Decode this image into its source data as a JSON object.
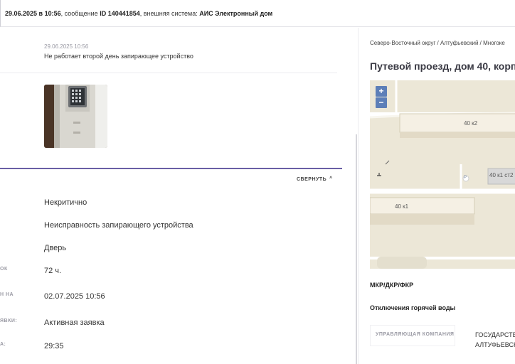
{
  "topbar": {
    "datetime": "29.06.2025 в 10:56",
    "message_prefix": ", сообщение ",
    "message_id": "ID 140441854",
    "system_prefix": ", внешняя система: ",
    "system_name": "АИС Электронный дом"
  },
  "message": {
    "date": "29.06.2025 10:56",
    "text": "Не работает второй день запирающее устройство"
  },
  "details": {
    "collapse_label": "СВЕРНУТЬ",
    "fields": [
      {
        "label": "",
        "value": "Некритично"
      },
      {
        "label": "",
        "value": "Неисправность запирающего устройства"
      },
      {
        "label": "",
        "value": "Дверь"
      },
      {
        "label": "ОК",
        "value": "72 ч."
      },
      {
        "label": "Н НА",
        "value": "02.07.2025 10:56"
      },
      {
        "label": "ЯВКИ:",
        "value": "Активная заявка"
      },
      {
        "label": "А:",
        "value": "29:35"
      }
    ]
  },
  "right": {
    "breadcrumb": "Северо-Восточный округ / Алтуфьевский / Многоке",
    "address": "Путевой проезд, дом 40, корпус",
    "map": {
      "zoom_in": "+",
      "zoom_out": "−",
      "labels": [
        "40 к2",
        "40 к1 ст2",
        "40 к1"
      ],
      "parking": "P"
    },
    "program_label": "МКР/ДКР/ФКР",
    "hot_water_label": "Отключения горячей воды",
    "company_label": "УПРАВЛЯЮЩАЯ КОМПАНИЯ",
    "company_value_line1": "ГОСУДАРСТВ",
    "company_value_line2": "АЛТУФЬЕВСК"
  }
}
